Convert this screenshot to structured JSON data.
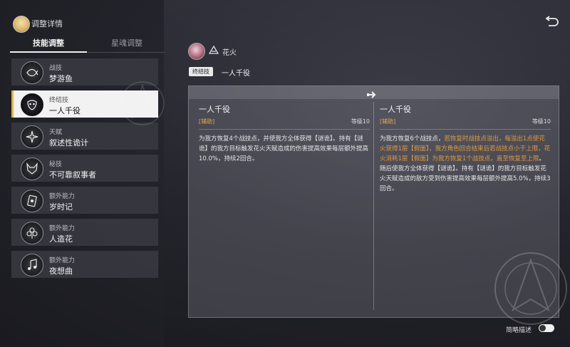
{
  "header": {
    "title": "调整详情"
  },
  "tabs": [
    {
      "label": "技能调整"
    },
    {
      "label": "星魂调整"
    }
  ],
  "skills": [
    {
      "type": "战技",
      "name": "梦游鱼",
      "icon": "fish-icon"
    },
    {
      "type": "终结技",
      "name": "一人千役",
      "icon": "mask-icon"
    },
    {
      "type": "天赋",
      "name": "叙述性诡计",
      "icon": "star-icon"
    },
    {
      "type": "秘技",
      "name": "不可靠叙事者",
      "icon": "fox-mask-icon"
    },
    {
      "type": "额外能力",
      "name": "岁时记",
      "icon": "card-icon"
    },
    {
      "type": "额外能力",
      "name": "人造花",
      "icon": "flower-icon"
    },
    {
      "type": "额外能力",
      "name": "夜想曲",
      "icon": "music-icon"
    }
  ],
  "character": {
    "name": "花火"
  },
  "selected_skill": {
    "tag": "终结技",
    "name": "一人千役"
  },
  "compare": {
    "old": {
      "title": "一人千役",
      "tag": "[辅助]",
      "level": "等级10",
      "segments": [
        {
          "text": "为我方恢复4个战技点，并使我方全体获得【谜诡】。持有【谜诡】的我方目标触发花火天赋造成的伤害提高效果每层额外提高10.0%，持续2回合。",
          "hl": false
        }
      ]
    },
    "new": {
      "title": "一人千役",
      "tag": "[辅助]",
      "level": "等级10",
      "segments": [
        {
          "text": "为我方恢复6个战技点，",
          "hl": false
        },
        {
          "text": "若恢复时战技点溢出，每溢出1点使花火获得1层【假面】，我方角色回合结束后若战技点小于上限，花火消耗1层【假面】为我方恢复1个战技点，直至恢复至上限",
          "hl": true
        },
        {
          "text": "。随后使我方全体获得【谜诡】。持有【谜诡】的我方目标触发花火天赋造成的敌方受到伤害提高效果每层额外提高5.0%，持续3回合。",
          "hl": false
        }
      ]
    }
  },
  "footer": {
    "toggle_label": "简略描述",
    "toggle_on": false
  }
}
